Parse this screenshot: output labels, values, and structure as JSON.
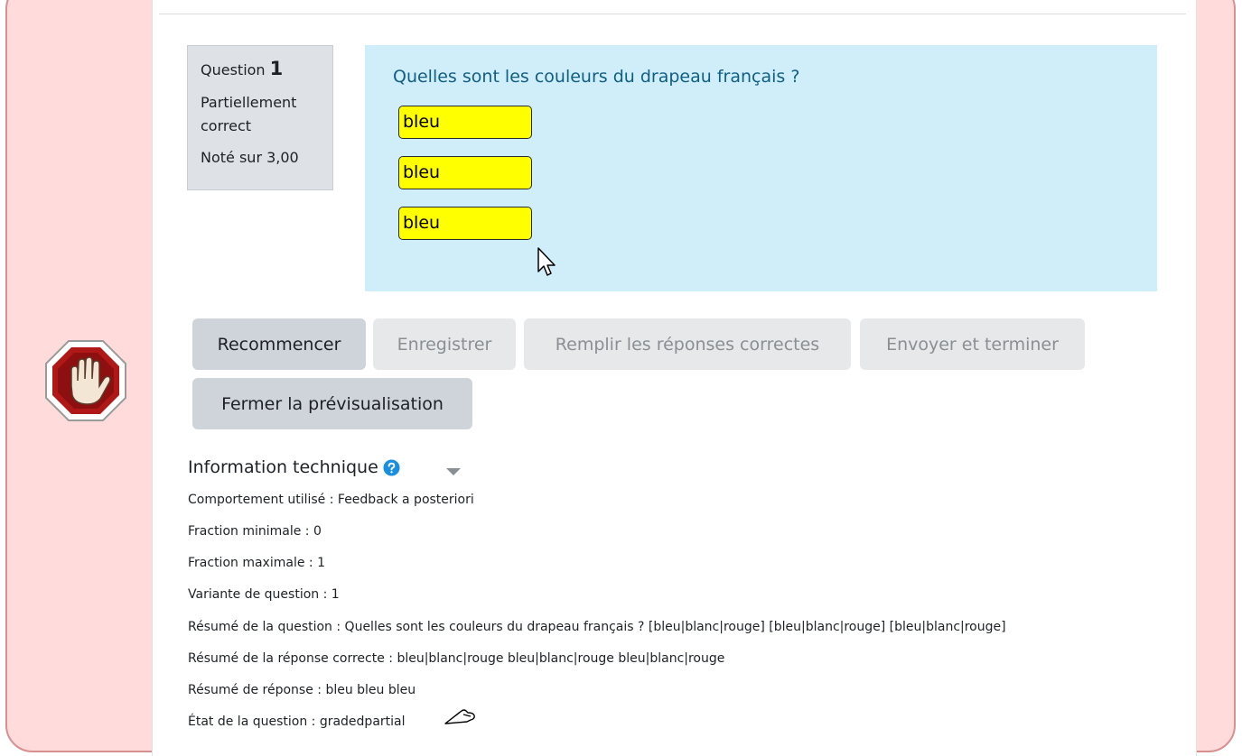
{
  "question": {
    "label": "Question",
    "number": "1",
    "state": "Partiellement correct",
    "grade": "Noté sur 3,00",
    "text": "Quelles sont les couleurs du drapeau français ?",
    "answers": [
      "bleu",
      "bleu",
      "bleu"
    ],
    "answer_highlight_color": "#ffff00",
    "content_bg_color": "#cfeef9"
  },
  "buttons": {
    "restart": "Recommencer",
    "save": "Enregistrer",
    "fill_correct": "Remplir les réponses correctes",
    "submit": "Envoyer et terminer",
    "close_preview": "Fermer la prévisualisation"
  },
  "technical_info": {
    "title": "Information technique",
    "lines": [
      "Comportement utilisé : Feedback a posteriori",
      "Fraction minimale : 0",
      "Fraction maximale : 1",
      "Variante de question : 1",
      "Résumé de la question : Quelles sont les couleurs du drapeau français ? [bleu|blanc|rouge] [bleu|blanc|rouge] [bleu|blanc|rouge]",
      "Résumé de la réponse correcte : bleu|blanc|rouge bleu|blanc|rouge bleu|blanc|rouge",
      "Résumé de réponse : bleu bleu bleu",
      "État de la question : gradedpartial"
    ]
  },
  "icons": {
    "stop": "stop-hand-icon",
    "help": "help-icon",
    "caret": "caret-down-icon",
    "mouse": "mouse-cursor-icon",
    "pointer": "hand-pointer-icon"
  },
  "colors": {
    "frame_bg": "#ffdbdb",
    "frame_border": "#d88f8f",
    "question_text": "#115e85"
  }
}
